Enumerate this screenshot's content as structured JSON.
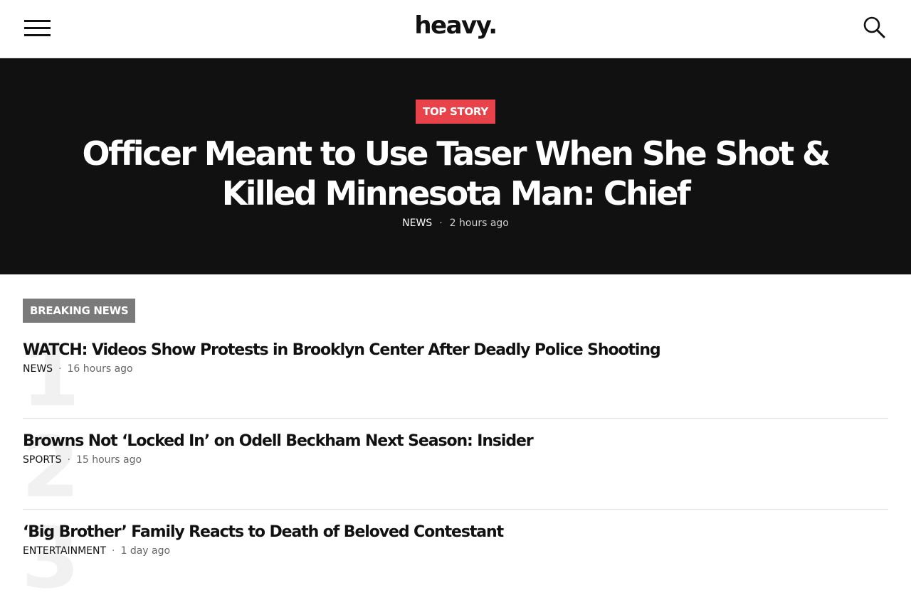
{
  "header": {
    "logo": "heavy."
  },
  "hero": {
    "badge": "TOP STORY",
    "title": "Officer Meant to Use Taser When She Shot & Killed Minnesota Man: Chief",
    "category": "NEWS",
    "separator": "·",
    "time": "2 hours ago"
  },
  "breaking": {
    "badge": "BREAKING NEWS",
    "items": [
      {
        "rank": "1",
        "title": "WATCH: Videos Show Protests in Brooklyn Center After Deadly Police Shooting",
        "category": "NEWS",
        "separator": "·",
        "time": "16 hours ago"
      },
      {
        "rank": "2",
        "title": "Browns Not ‘Locked In’ on Odell Beckham Next Season: Insider",
        "category": "SPORTS",
        "separator": "·",
        "time": "15 hours ago"
      },
      {
        "rank": "3",
        "title": "‘Big Brother’ Family Reacts to Death of Beloved Contestant",
        "category": "ENTERTAINMENT",
        "separator": "·",
        "time": "1 day ago"
      }
    ]
  },
  "colors": {
    "accent": "#e8424a",
    "hero_bg": "#111111",
    "breaking_badge": "#7a7a7a"
  }
}
